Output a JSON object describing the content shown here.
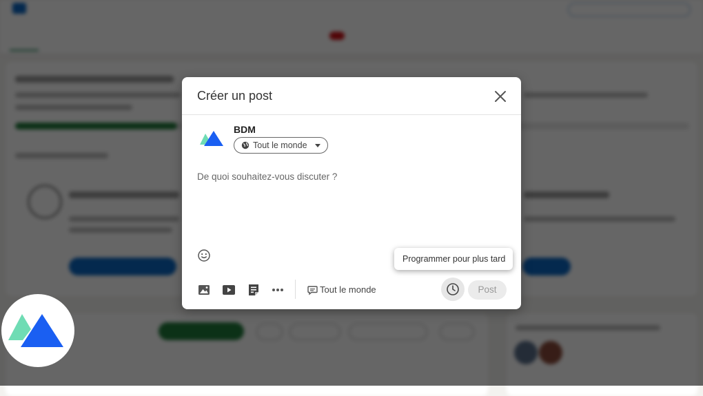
{
  "modal": {
    "title": "Créer un post",
    "author_name": "BDM",
    "audience_label": "Tout le monde",
    "placeholder": "De quoi souhaitez-vous discuter ?",
    "comment_audience_label": "Tout le monde",
    "post_label": "Post",
    "tooltip": "Programmer pour plus tard"
  },
  "icons": {
    "close": "close-icon",
    "globe": "globe-icon",
    "emoji": "emoji-icon",
    "photo": "photo-icon",
    "video": "video-icon",
    "document": "document-icon",
    "more": "more-icon",
    "comment": "comment-icon",
    "clock": "clock-icon"
  },
  "colors": {
    "brand_teal": "#6fdcb4",
    "brand_blue": "#1a5ff2",
    "overlay": "rgba(0,0,0,0.6)"
  }
}
